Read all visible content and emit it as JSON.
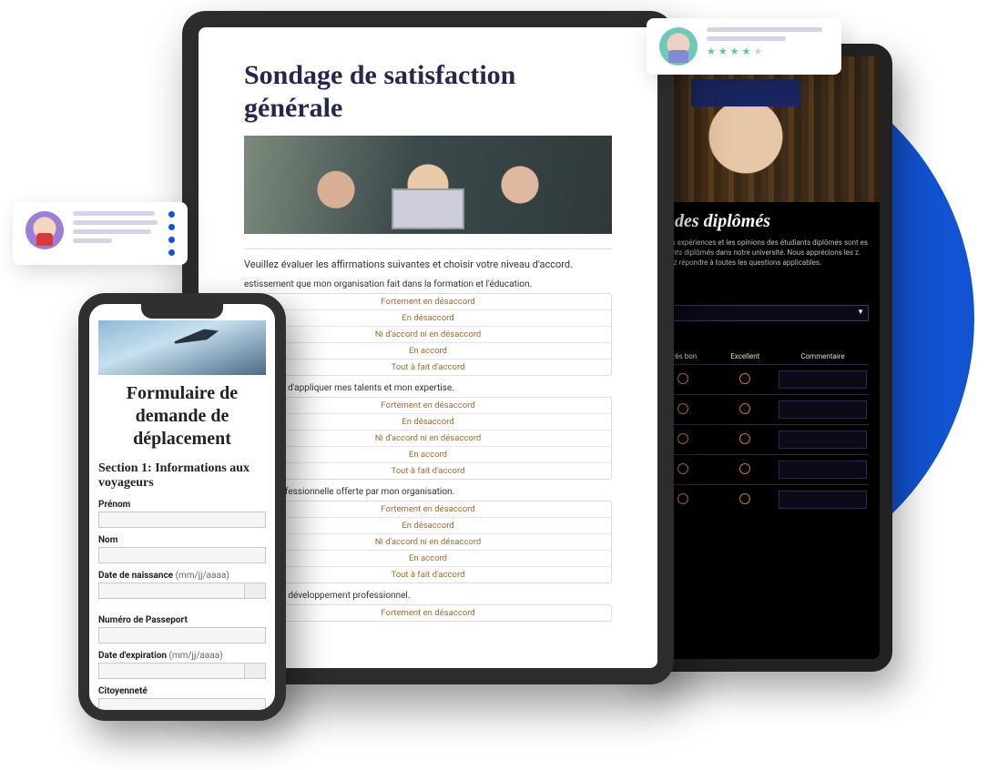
{
  "tablet1": {
    "title": "Sondage de satisfaction générale",
    "intro": "Veuillez évaluer les affirmations suivantes et choisir votre niveau d'accord.",
    "q1": "estissement que mon organisation fait dans la formation et l'éducation.",
    "q2": "possibilité d'appliquer mes talents et mon expertise.",
    "q3": "nation professionnelle offerte par mon organisation.",
    "q4": "liée à mon développement professionnel.",
    "likert": {
      "o1": "Fortement en désaccord",
      "o2": "En désaccord",
      "o3": "Ni d'accord ni en désaccord",
      "o4": "En accord",
      "o5": "Tout à fait d'accord"
    }
  },
  "phone": {
    "title": "Formulaire de demande de déplacement",
    "section1": "Section 1: Informations aux voyageurs",
    "labels": {
      "prenom": "Prénom",
      "nom": "Nom",
      "dob": "Date de naissance",
      "dob_hint": "(mm/jj/aaaa)",
      "passport": "Numéro de Passeport",
      "expiry": "Date d'expiration",
      "expiry_hint": "(mm/jj/aaaa)",
      "citizen": "Citoyenneté"
    }
  },
  "tablet2": {
    "title": "tie des diplômés",
    "desc": "ire. Les expériences et les opinions des étudiants diplômés sont es étudiants diplômés dans notre université. Nous apprécions les z. Veuillez répondre à toutes les questions applicables.",
    "cols": {
      "c1": "Très bon",
      "c2": "Excellent",
      "c3": "Commentaire"
    }
  }
}
